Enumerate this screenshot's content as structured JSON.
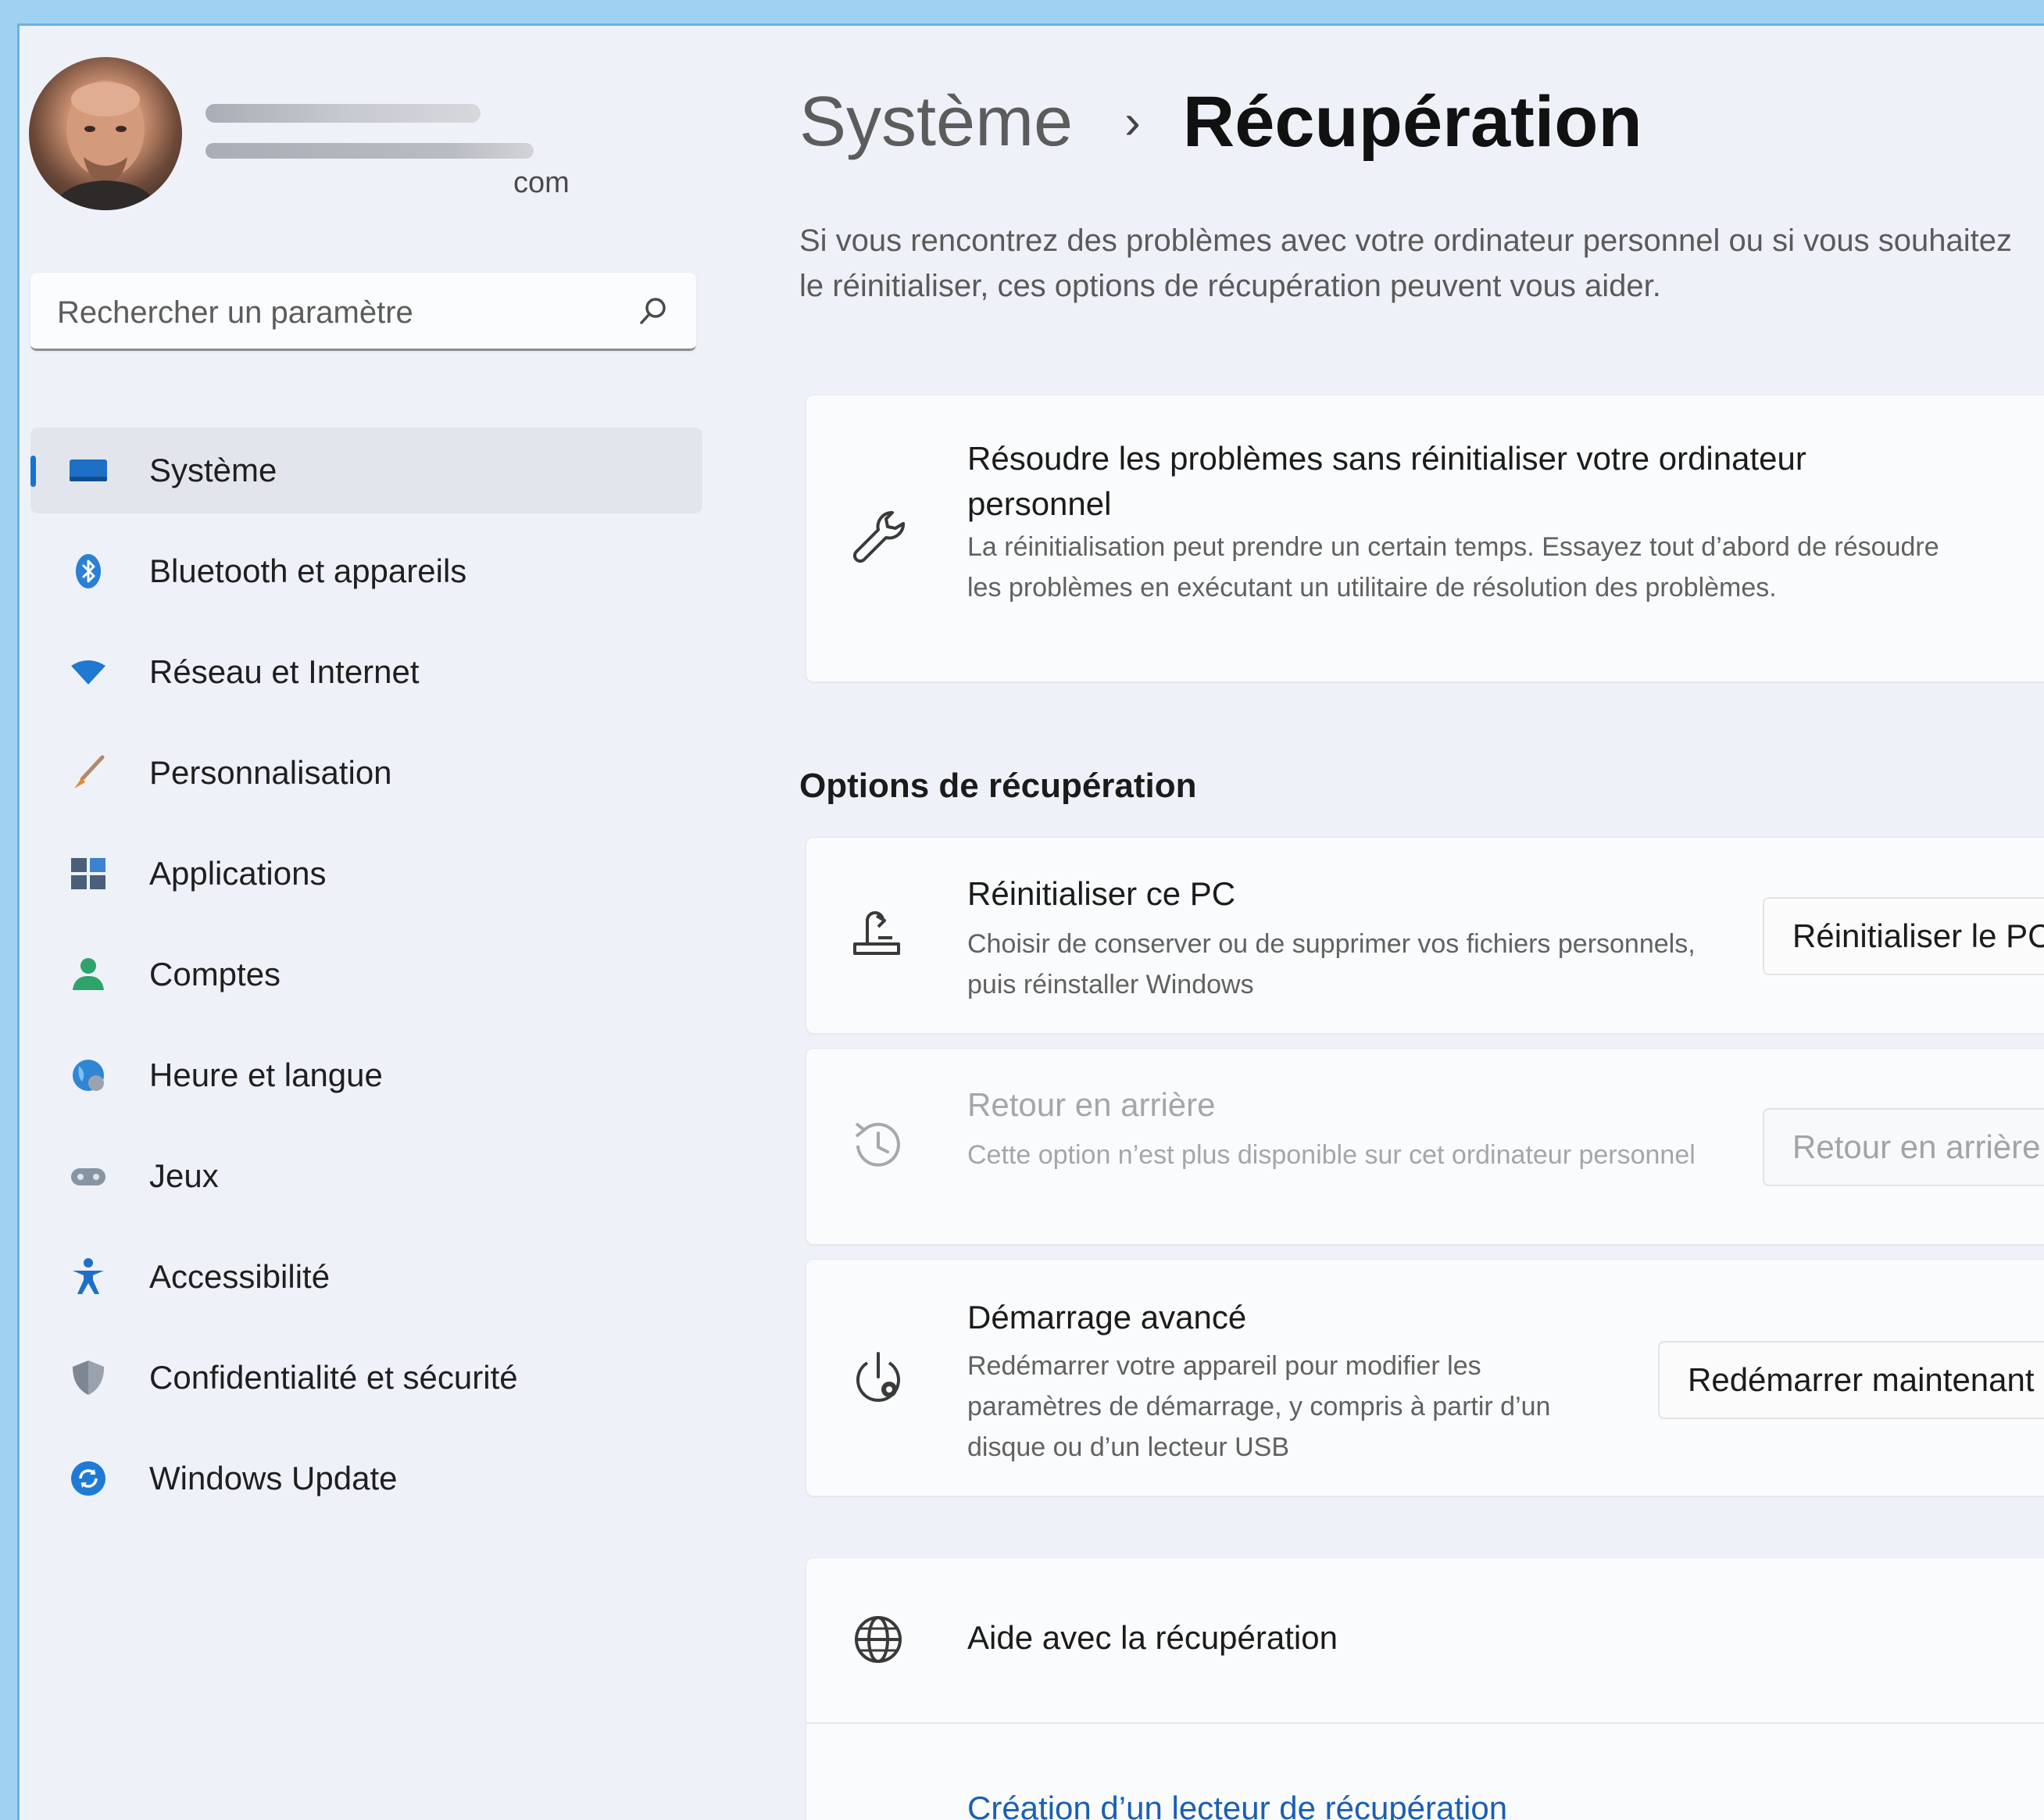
{
  "account": {
    "email_suffix": "com"
  },
  "search": {
    "placeholder": "Rechercher un paramètre"
  },
  "sidebar": {
    "items": [
      {
        "label": "Système",
        "icon": "monitor-icon",
        "active": true
      },
      {
        "label": "Bluetooth et appareils",
        "icon": "bluetooth-icon"
      },
      {
        "label": "Réseau et Internet",
        "icon": "wifi-icon"
      },
      {
        "label": "Personnalisation",
        "icon": "brush-icon"
      },
      {
        "label": "Applications",
        "icon": "apps-icon"
      },
      {
        "label": "Comptes",
        "icon": "person-icon"
      },
      {
        "label": "Heure et langue",
        "icon": "globe-clock-icon"
      },
      {
        "label": "Jeux",
        "icon": "gamepad-icon"
      },
      {
        "label": "Accessibilité",
        "icon": "accessibility-icon"
      },
      {
        "label": "Confidentialité et sécurité",
        "icon": "shield-icon"
      },
      {
        "label": "Windows Update",
        "icon": "update-icon"
      }
    ]
  },
  "breadcrumb": {
    "parent": "Système",
    "separator": "›",
    "current": "Récupération"
  },
  "intro": "Si vous rencontrez des problèmes avec votre ordinateur personnel ou si vous souhaitez le réinitialiser, ces options de récupération peuvent vous aider.",
  "troubleshoot_card": {
    "title": "Résoudre les problèmes sans réinitialiser votre ordinateur personnel",
    "description": "La réinitialisation peut prendre un certain temps. Essayez tout d’abord de résoudre les problèmes en exécutant un utilitaire de résolution des problèmes.",
    "icon": "wrench-icon"
  },
  "recovery_options": {
    "heading": "Options de récupération",
    "items": [
      {
        "title": "Réinitialiser ce PC",
        "description": "Choisir de conserver ou de supprimer vos fichiers personnels, puis réinstaller Windows",
        "button": "Réinitialiser le PC",
        "icon": "reset-pc-icon",
        "enabled": true
      },
      {
        "title": "Retour en arrière",
        "description": "Cette option n’est plus disponible sur cet ordinateur personnel",
        "button": "Retour en arrière",
        "icon": "history-icon",
        "enabled": false
      },
      {
        "title": "Démarrage avancé",
        "description": "Redémarrer votre appareil pour modifier les paramètres de démarrage, y compris à partir d’un disque ou d’un lecteur USB",
        "button": "Redémarrer maintenant",
        "icon": "power-gear-icon",
        "enabled": true
      }
    ]
  },
  "help": {
    "title": "Aide avec la récupération",
    "link": "Création d’un lecteur de récupération",
    "icon": "globe-icon"
  },
  "colors": {
    "accent": "#1873cf",
    "link": "#1a5fb4",
    "background": "#eef2f8",
    "card": "#fafbfc"
  }
}
